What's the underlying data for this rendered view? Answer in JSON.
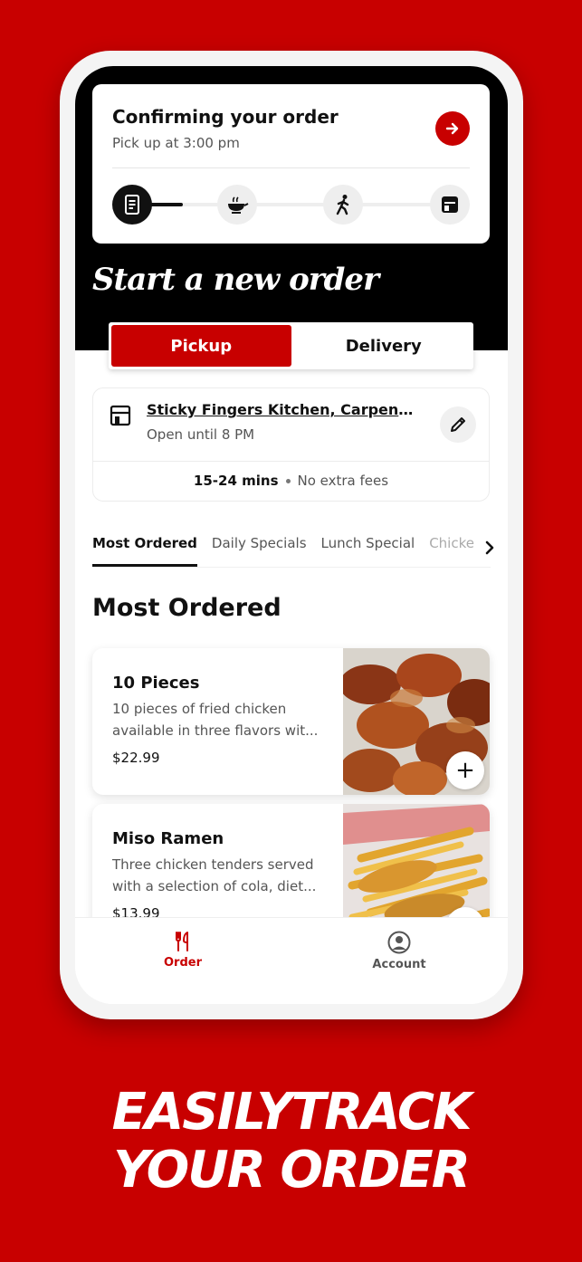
{
  "status": {
    "title": "Confirming your order",
    "subtitle": "Pick up at 3:00 pm"
  },
  "new_order": {
    "title": "Start a new order",
    "modes": [
      "Pickup",
      "Delivery"
    ],
    "selected_mode": "Pickup"
  },
  "store": {
    "name": "Sticky Fingers Kitchen, Carpenters...",
    "hours": "Open until 8 PM",
    "eta": "15-24 mins",
    "fees": "No extra fees"
  },
  "categories": {
    "tabs": [
      "Most Ordered",
      "Daily Specials",
      "Lunch Special",
      "Chicke"
    ],
    "active": "Most Ordered"
  },
  "section_title": "Most Ordered",
  "items": [
    {
      "name": "10 Pieces",
      "description": "10 pieces of fried chicken available in three flavors wit...",
      "price": "$22.99"
    },
    {
      "name": "Miso Ramen",
      "description": "Three chicken tenders served with a selection of cola, diet...",
      "price": "$13.99"
    }
  ],
  "nav": {
    "order_label": "Order",
    "account_label": "Account"
  },
  "promo": {
    "line1": "EASILYTRACK",
    "line2": "YOUR ORDER"
  },
  "colors": {
    "brand_red": "#c80000",
    "black": "#000000"
  }
}
